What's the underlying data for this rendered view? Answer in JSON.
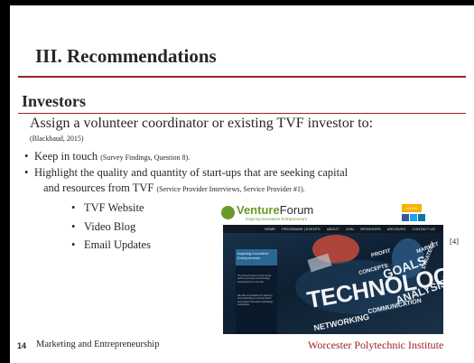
{
  "title": "III. Recommendations",
  "section": "Investors",
  "lead": "Assign a volunteer coordinator or existing TVF investor to:",
  "lead_citation": "(Blackbaud, 2015)",
  "bullets": [
    {
      "text": "Keep in touch",
      "citation": "(Survey Findings, Question 8)."
    },
    {
      "text": "Highlight the quality and quantity of start-ups that are seeking capital",
      "text2": "and resources from TVF",
      "citation": "(Service Provider Interviews, Service Provider #1)."
    }
  ],
  "subitems": [
    "TVF Website",
    "Video Blog",
    "Email Updates"
  ],
  "reference_marker": "[4]",
  "footer": {
    "page_number": "14",
    "left": "Marketing and Entrepreneurship",
    "right": "Worcester Polytechnic Institute"
  },
  "website": {
    "logo_prefix": "Venture",
    "logo_suffix": "Forum",
    "logo_tagline": "inspiring innovative Entrepreneurs",
    "login": "LOGIN",
    "nav": [
      "HOME",
      "PROGRAMS | EVENTS",
      "ABOUT",
      "JOIN",
      "SPONSORS",
      "ARCHIVES",
      "CONTACT US"
    ],
    "panel_title": "Inspiring Innovative Entrepreneurs",
    "panel_text_1": "The Venture Forum is the not-for-profit community for technology entrepreneurs on the rise.",
    "panel_text_2": "We offer a foundation for learning and networking to entrepreneurs and support innovative technology businesses.",
    "hero_word": "TECHNOLOGY",
    "cloud_words": [
      "GOALS",
      "STRATEGY",
      "MARKET",
      "NETWORKING",
      "COMMUNICATION",
      "ANALYSIS",
      "CONCEPTS",
      "PROFIT"
    ],
    "colors": {
      "logo_green": "#6a9a2a",
      "login_yellow": "#f3b300",
      "facebook": "#3b5998",
      "twitter": "#1da1f2",
      "linkedin": "#0e76a8"
    }
  },
  "colors": {
    "accent": "#9b2226",
    "text": "#262626"
  }
}
